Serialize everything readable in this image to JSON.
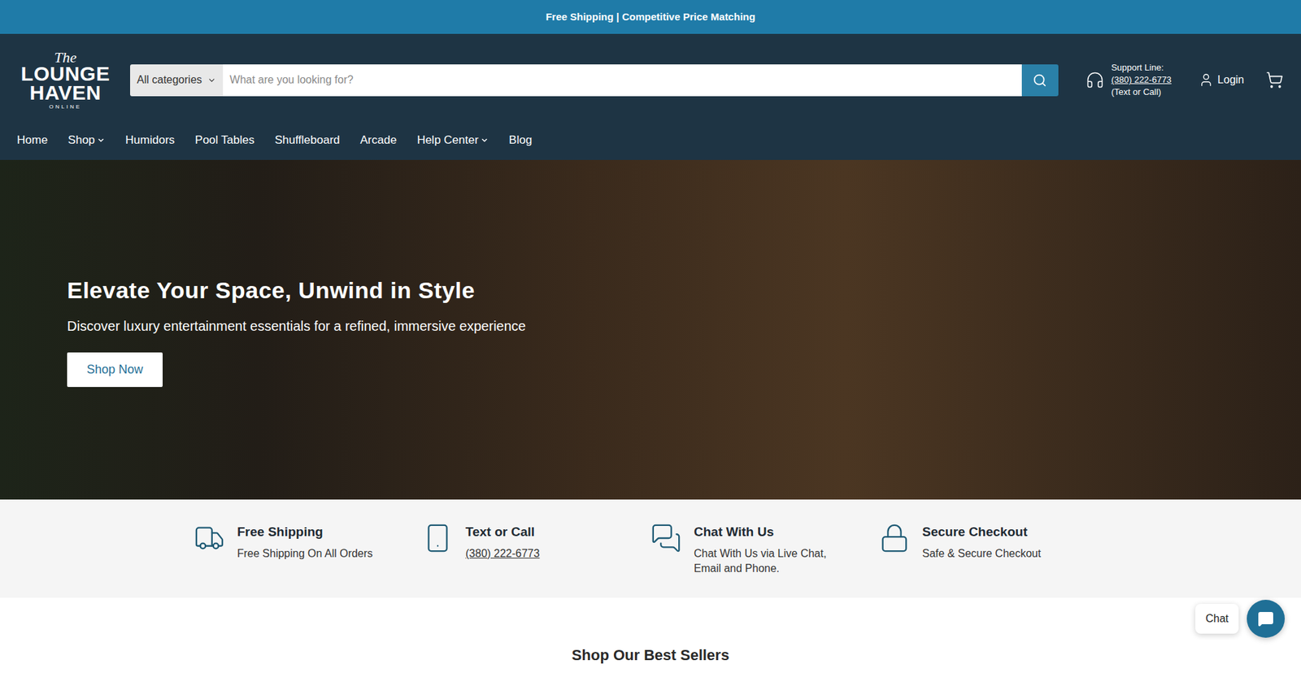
{
  "announcement": "Free Shipping | Competitive Price Matching",
  "logo": {
    "script": "The",
    "line1": "LOUNGE",
    "line2": "HAVEN",
    "tag": "ONLINE"
  },
  "search": {
    "category": "All categories",
    "placeholder": "What are you looking for?"
  },
  "support": {
    "label": "Support Line:",
    "phone": "(380) 222-6773",
    "note": "(Text or Call)"
  },
  "login": "Login",
  "nav": [
    {
      "label": "Home",
      "dropdown": false
    },
    {
      "label": "Shop",
      "dropdown": true
    },
    {
      "label": "Humidors",
      "dropdown": false
    },
    {
      "label": "Pool Tables",
      "dropdown": false
    },
    {
      "label": "Shuffleboard",
      "dropdown": false
    },
    {
      "label": "Arcade",
      "dropdown": false
    },
    {
      "label": "Help Center",
      "dropdown": true
    },
    {
      "label": "Blog",
      "dropdown": false
    }
  ],
  "hero": {
    "title": "Elevate Your Space, Unwind in Style",
    "subtitle": "Discover luxury entertainment essentials for a refined, immersive experience",
    "button": "Shop Now"
  },
  "features": [
    {
      "kind": "truck",
      "title": "Free Shipping",
      "text": "Free Shipping On All Orders",
      "link": false
    },
    {
      "kind": "phone",
      "title": "Text or Call",
      "text": "(380) 222-6773",
      "link": true
    },
    {
      "kind": "chat",
      "title": "Chat With Us",
      "text": "Chat With Us via Live Chat, Email and Phone.",
      "link": false
    },
    {
      "kind": "lock",
      "title": "Secure Checkout",
      "text": "Safe & Secure Checkout",
      "link": false
    }
  ],
  "best_sellers": "Shop Our Best Sellers",
  "chat_widget": "Chat"
}
